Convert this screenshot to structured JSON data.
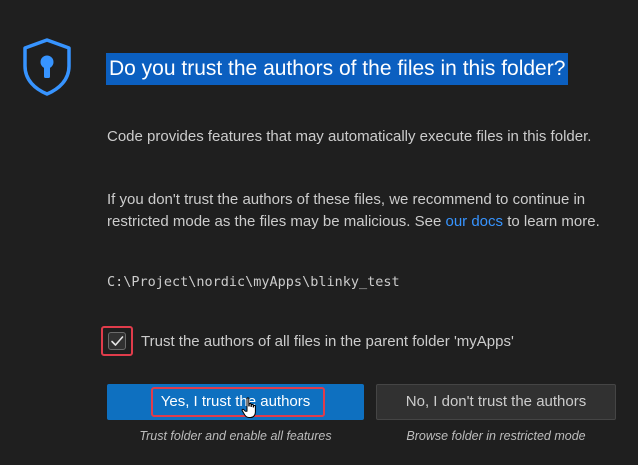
{
  "dialog": {
    "title": "Do you trust the authors of the files in this folder?",
    "paragraph1": "Code provides features that may automatically execute files in this folder.",
    "paragraph2_before": "If you don't trust the authors of these files, we recommend to continue in restricted mode as the files may be malicious. See ",
    "paragraph2_link": "our docs",
    "paragraph2_after": " to learn more.",
    "folder_path": "C:\\Project\\nordic\\myApps\\blinky_test",
    "checkbox_label": "Trust the authors of all files in the parent folder 'myApps'",
    "checkbox_checked": true,
    "yes_button": "Yes, I trust the authors",
    "yes_caption": "Trust folder and enable all features",
    "no_button": "No, I don't trust the authors",
    "no_caption": "Browse folder in restricted mode"
  },
  "colors": {
    "background": "#1f1f1f",
    "primary_button": "#0e70c0",
    "title_highlight": "#0b5fc0",
    "link": "#3794ff",
    "annotation": "#e03c4b"
  },
  "icons": {
    "header": "shield-lock-icon",
    "checkbox_mark": "checkmark-icon",
    "cursor": "hand-pointer-icon"
  }
}
